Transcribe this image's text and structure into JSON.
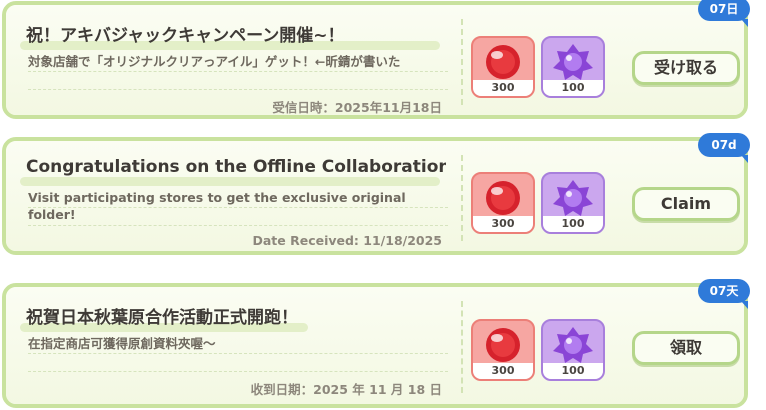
{
  "mails": [
    {
      "title": "祝！アキバジャックキャンペーン開催~！",
      "description": "対象店舗で「オリジナルクリアっアイル」ゲット！←昕錆が書いた",
      "date": "受信日時：2025年11月18日",
      "claim_label": "受け取る",
      "badge": "07日",
      "rewards": [
        {
          "icon": "red-orb-icon",
          "count": "300"
        },
        {
          "icon": "purple-gem-icon",
          "count": "100"
        }
      ]
    },
    {
      "title": "Congratulations on the Offline Collaboration Eve",
      "description": "Visit participating stores to get the exclusive original folder!",
      "date": "Date Received: 11/18/2025",
      "claim_label": "Claim",
      "badge": "07d",
      "rewards": [
        {
          "icon": "red-orb-icon",
          "count": "300"
        },
        {
          "icon": "purple-gem-icon",
          "count": "100"
        }
      ]
    },
    {
      "title": "祝賀日本秋葉原合作活動正式開跑！",
      "description": "在指定商店可獲得原創資料夾喔～",
      "date": "收到日期：2025 年 11 月 18 日",
      "claim_label": "領取",
      "badge": "07天",
      "rewards": [
        {
          "icon": "red-orb-icon",
          "count": "300"
        },
        {
          "icon": "purple-gem-icon",
          "count": "100"
        }
      ]
    }
  ],
  "colors": {
    "card_border": "#c9e29e",
    "card_bg": "#f6f9ea",
    "badge": "#2f7ad9",
    "red_item": "#f6a6a2",
    "purple_item": "#cba7ee"
  }
}
